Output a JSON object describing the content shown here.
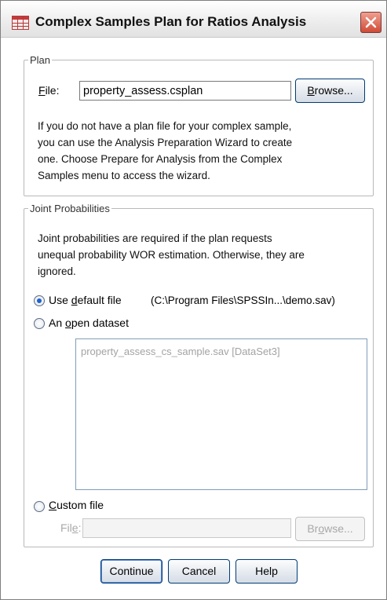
{
  "window": {
    "title": "Complex Samples Plan for Ratios Analysis"
  },
  "plan": {
    "legend": "Plan",
    "file_label_prefix": "F",
    "file_label_rest": "ile:",
    "file_value": "property_assess.csplan",
    "browse_prefix": "B",
    "browse_rest": "rowse...",
    "info_lines": [
      "If you do not have a plan file for your complex sample,",
      "you can use the Analysis Preparation Wizard to create",
      "one. Choose Prepare for Analysis from the Complex",
      "Samples menu to access the wizard."
    ]
  },
  "joint": {
    "legend": "Joint Probabilities",
    "info_lines": [
      "Joint probabilities are required if the plan requests",
      "unequal probability WOR estimation. Otherwise, they are",
      "ignored."
    ],
    "use_default_prefix": "Use ",
    "use_default_underlined": "d",
    "use_default_rest": "efault file",
    "default_path": "(C:\\Program Files\\SPSSIn...\\demo.sav)",
    "open_dataset_prefix": "An ",
    "open_dataset_underlined": "o",
    "open_dataset_rest": "pen dataset",
    "dataset_item": "property_assess_cs_sample.sav [DataSet3]",
    "custom_underlined": "C",
    "custom_rest": "ustom file",
    "custom_file_label_prefix": "Fil",
    "custom_file_label_underlined": "e",
    "custom_file_label_rest": ":",
    "custom_file_value": "",
    "custom_browse_prefix": "Br",
    "custom_browse_underlined": "o",
    "custom_browse_rest": "wse...",
    "selected": "use_default"
  },
  "buttons": {
    "continue": "Continue",
    "cancel": "Cancel",
    "help": "Help"
  },
  "colors": {
    "accent": "#1e62d0",
    "close": "#d04a36"
  }
}
